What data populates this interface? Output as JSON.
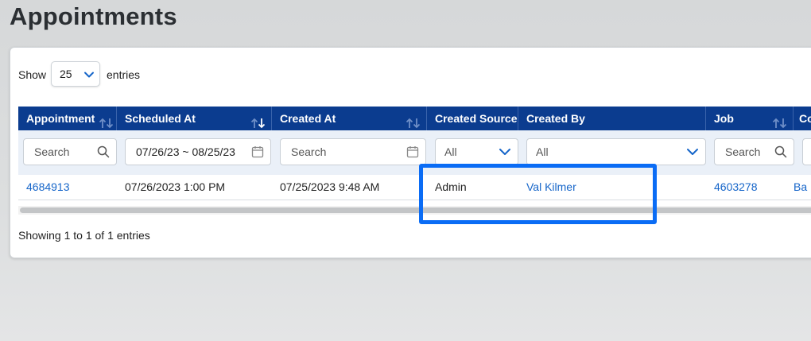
{
  "page": {
    "title": "Appointments"
  },
  "length_control": {
    "show_label": "Show",
    "selected": "25",
    "entries_label": "entries"
  },
  "table": {
    "columns": [
      "Appointment",
      "Scheduled At",
      "Created At",
      "Created Source",
      "Created By",
      "Job",
      "Co"
    ],
    "filters": {
      "appointment_placeholder": "Search",
      "scheduled_range": "07/26/23 ~ 08/25/23",
      "created_at_placeholder": "Search",
      "created_source_selected": "All",
      "created_by_selected": "All",
      "job_placeholder": "Search"
    },
    "rows": [
      {
        "appointment": "4684913",
        "scheduled_at": "07/26/2023 1:00 PM",
        "created_at": "07/25/2023 9:48 AM",
        "created_source": "Admin",
        "created_by": "Val Kilmer",
        "job": "4603278",
        "co": "Ba"
      }
    ]
  },
  "footer": {
    "info": "Showing 1 to 1 of 1 entries"
  },
  "colors": {
    "header_bg": "#0b3c8f",
    "link": "#1565c9",
    "highlight": "#0a6cf5"
  }
}
